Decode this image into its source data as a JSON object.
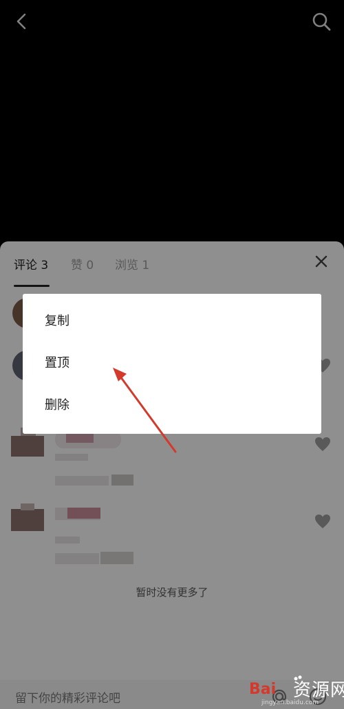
{
  "header": {
    "back_icon": "chevron-left-icon",
    "search_icon": "search-icon"
  },
  "tabs": [
    {
      "label": "评论 3",
      "active": true
    },
    {
      "label": "赞 0",
      "active": false
    },
    {
      "label": "浏览 1",
      "active": false
    }
  ],
  "close_icon": "close-icon",
  "status": {
    "no_more": "暂时没有更多了"
  },
  "composer": {
    "placeholder": "留下你的精彩评论吧",
    "at_icon": "at-icon",
    "emoji_icon": "emoji-icon"
  },
  "context_menu": {
    "items": [
      {
        "label": "复制"
      },
      {
        "label": "置顶"
      },
      {
        "label": "删除"
      }
    ]
  },
  "watermark": {
    "text": "资源网",
    "url": "jingyan.baidu.com"
  },
  "colors": {
    "annotation_arrow": "#d33a2c",
    "page_background": "#000000",
    "sheet_background": "#f6f6f6",
    "menu_background": "#ffffff"
  }
}
